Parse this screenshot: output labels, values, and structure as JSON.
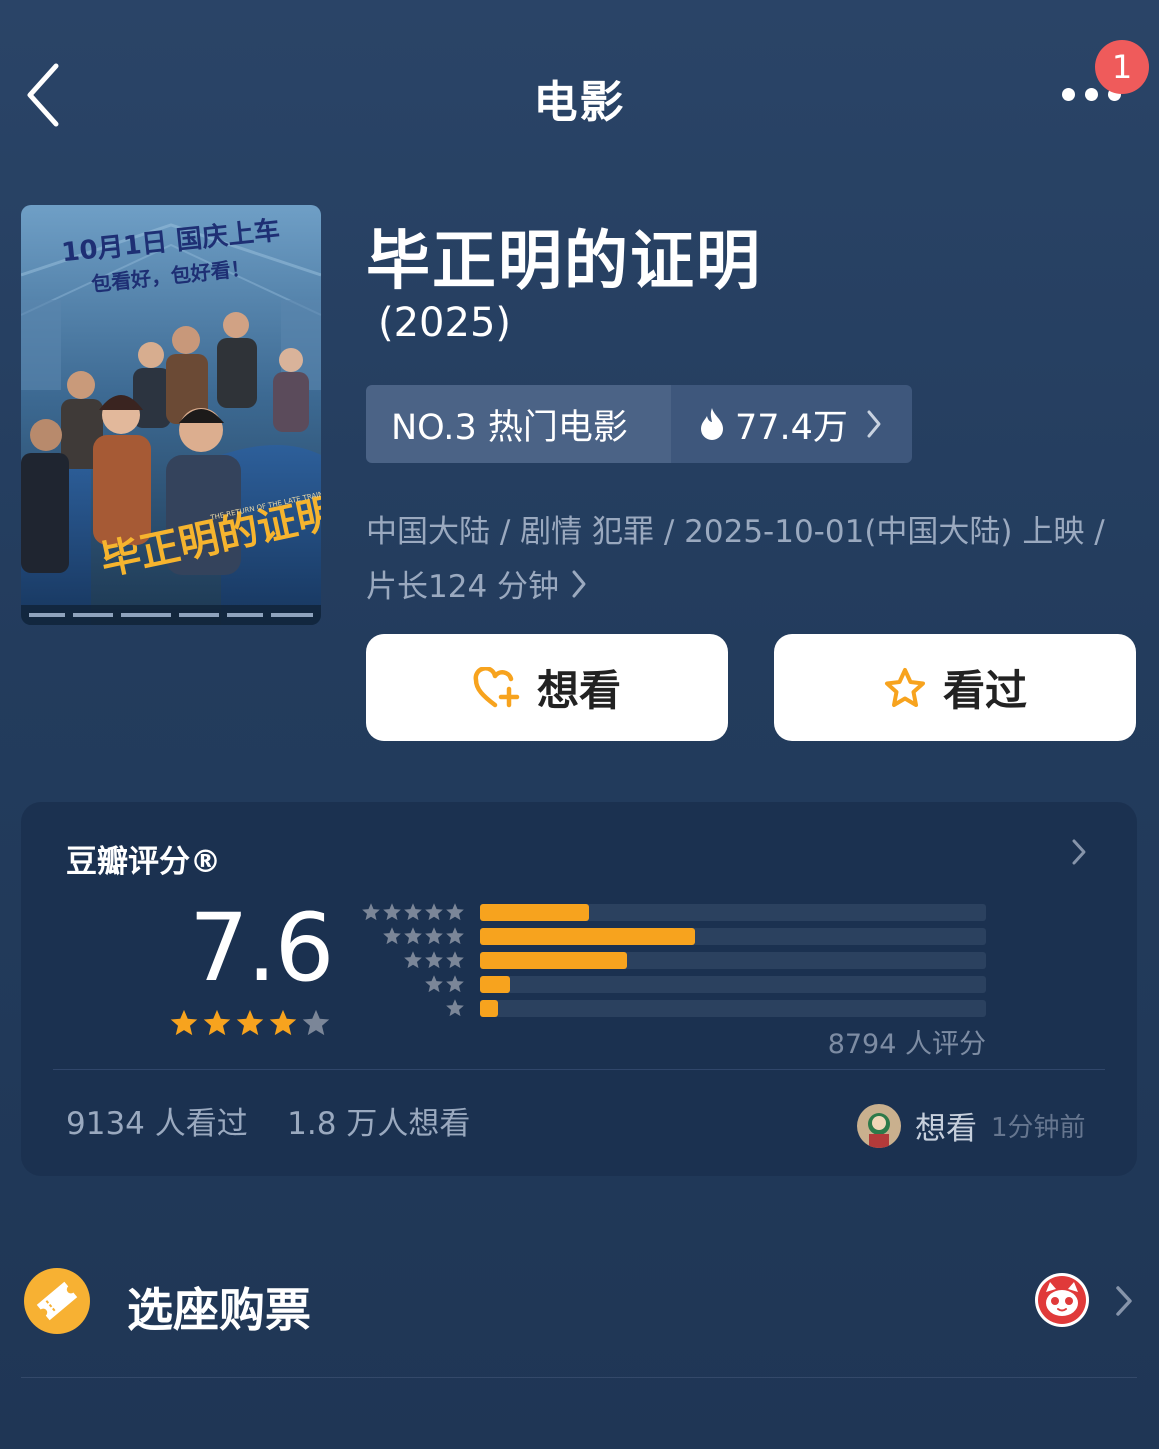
{
  "header": {
    "title": "电影",
    "notification_count": "1",
    "back_icon": "chevron-left-icon",
    "more_icon": "more-dots-icon"
  },
  "movie": {
    "title": "毕正明的证明",
    "year": "(2025)",
    "rank_label": "NO.3 热门电影",
    "heat_value": "77.4万",
    "meta_line1": "中国大陆 / 剧情 犯罪 / 2025-10-01(中国大陆) 上映 /",
    "meta_line2": "片长124 分钟",
    "poster": {
      "headline": "10月1日 国庆上车",
      "tagline": "包看好，包好看！",
      "title_art": "毕正明的证明",
      "english": "THE RETURN OF THE LATE TRAIN"
    }
  },
  "actions": {
    "want_label": "想看",
    "seen_label": "看过",
    "accent": "#f7a31e"
  },
  "rating": {
    "title": "豆瓣评分®",
    "score": "7.6",
    "stars_filled": 4,
    "distribution": [
      {
        "stars": 5,
        "percent": 21.5
      },
      {
        "stars": 4,
        "percent": 42.5
      },
      {
        "stars": 3,
        "percent": 29.0
      },
      {
        "stars": 2,
        "percent": 6.0
      },
      {
        "stars": 1,
        "percent": 3.5
      }
    ],
    "count_text": "8794 人评分",
    "stats_text": "9134 人看过    1.8 万人想看",
    "activity_label": "想看",
    "activity_time": "1分钟前"
  },
  "ticket": {
    "label": "选座购票",
    "icon": "ticket-icon",
    "partner_icon": "maoyan-cat-icon"
  }
}
